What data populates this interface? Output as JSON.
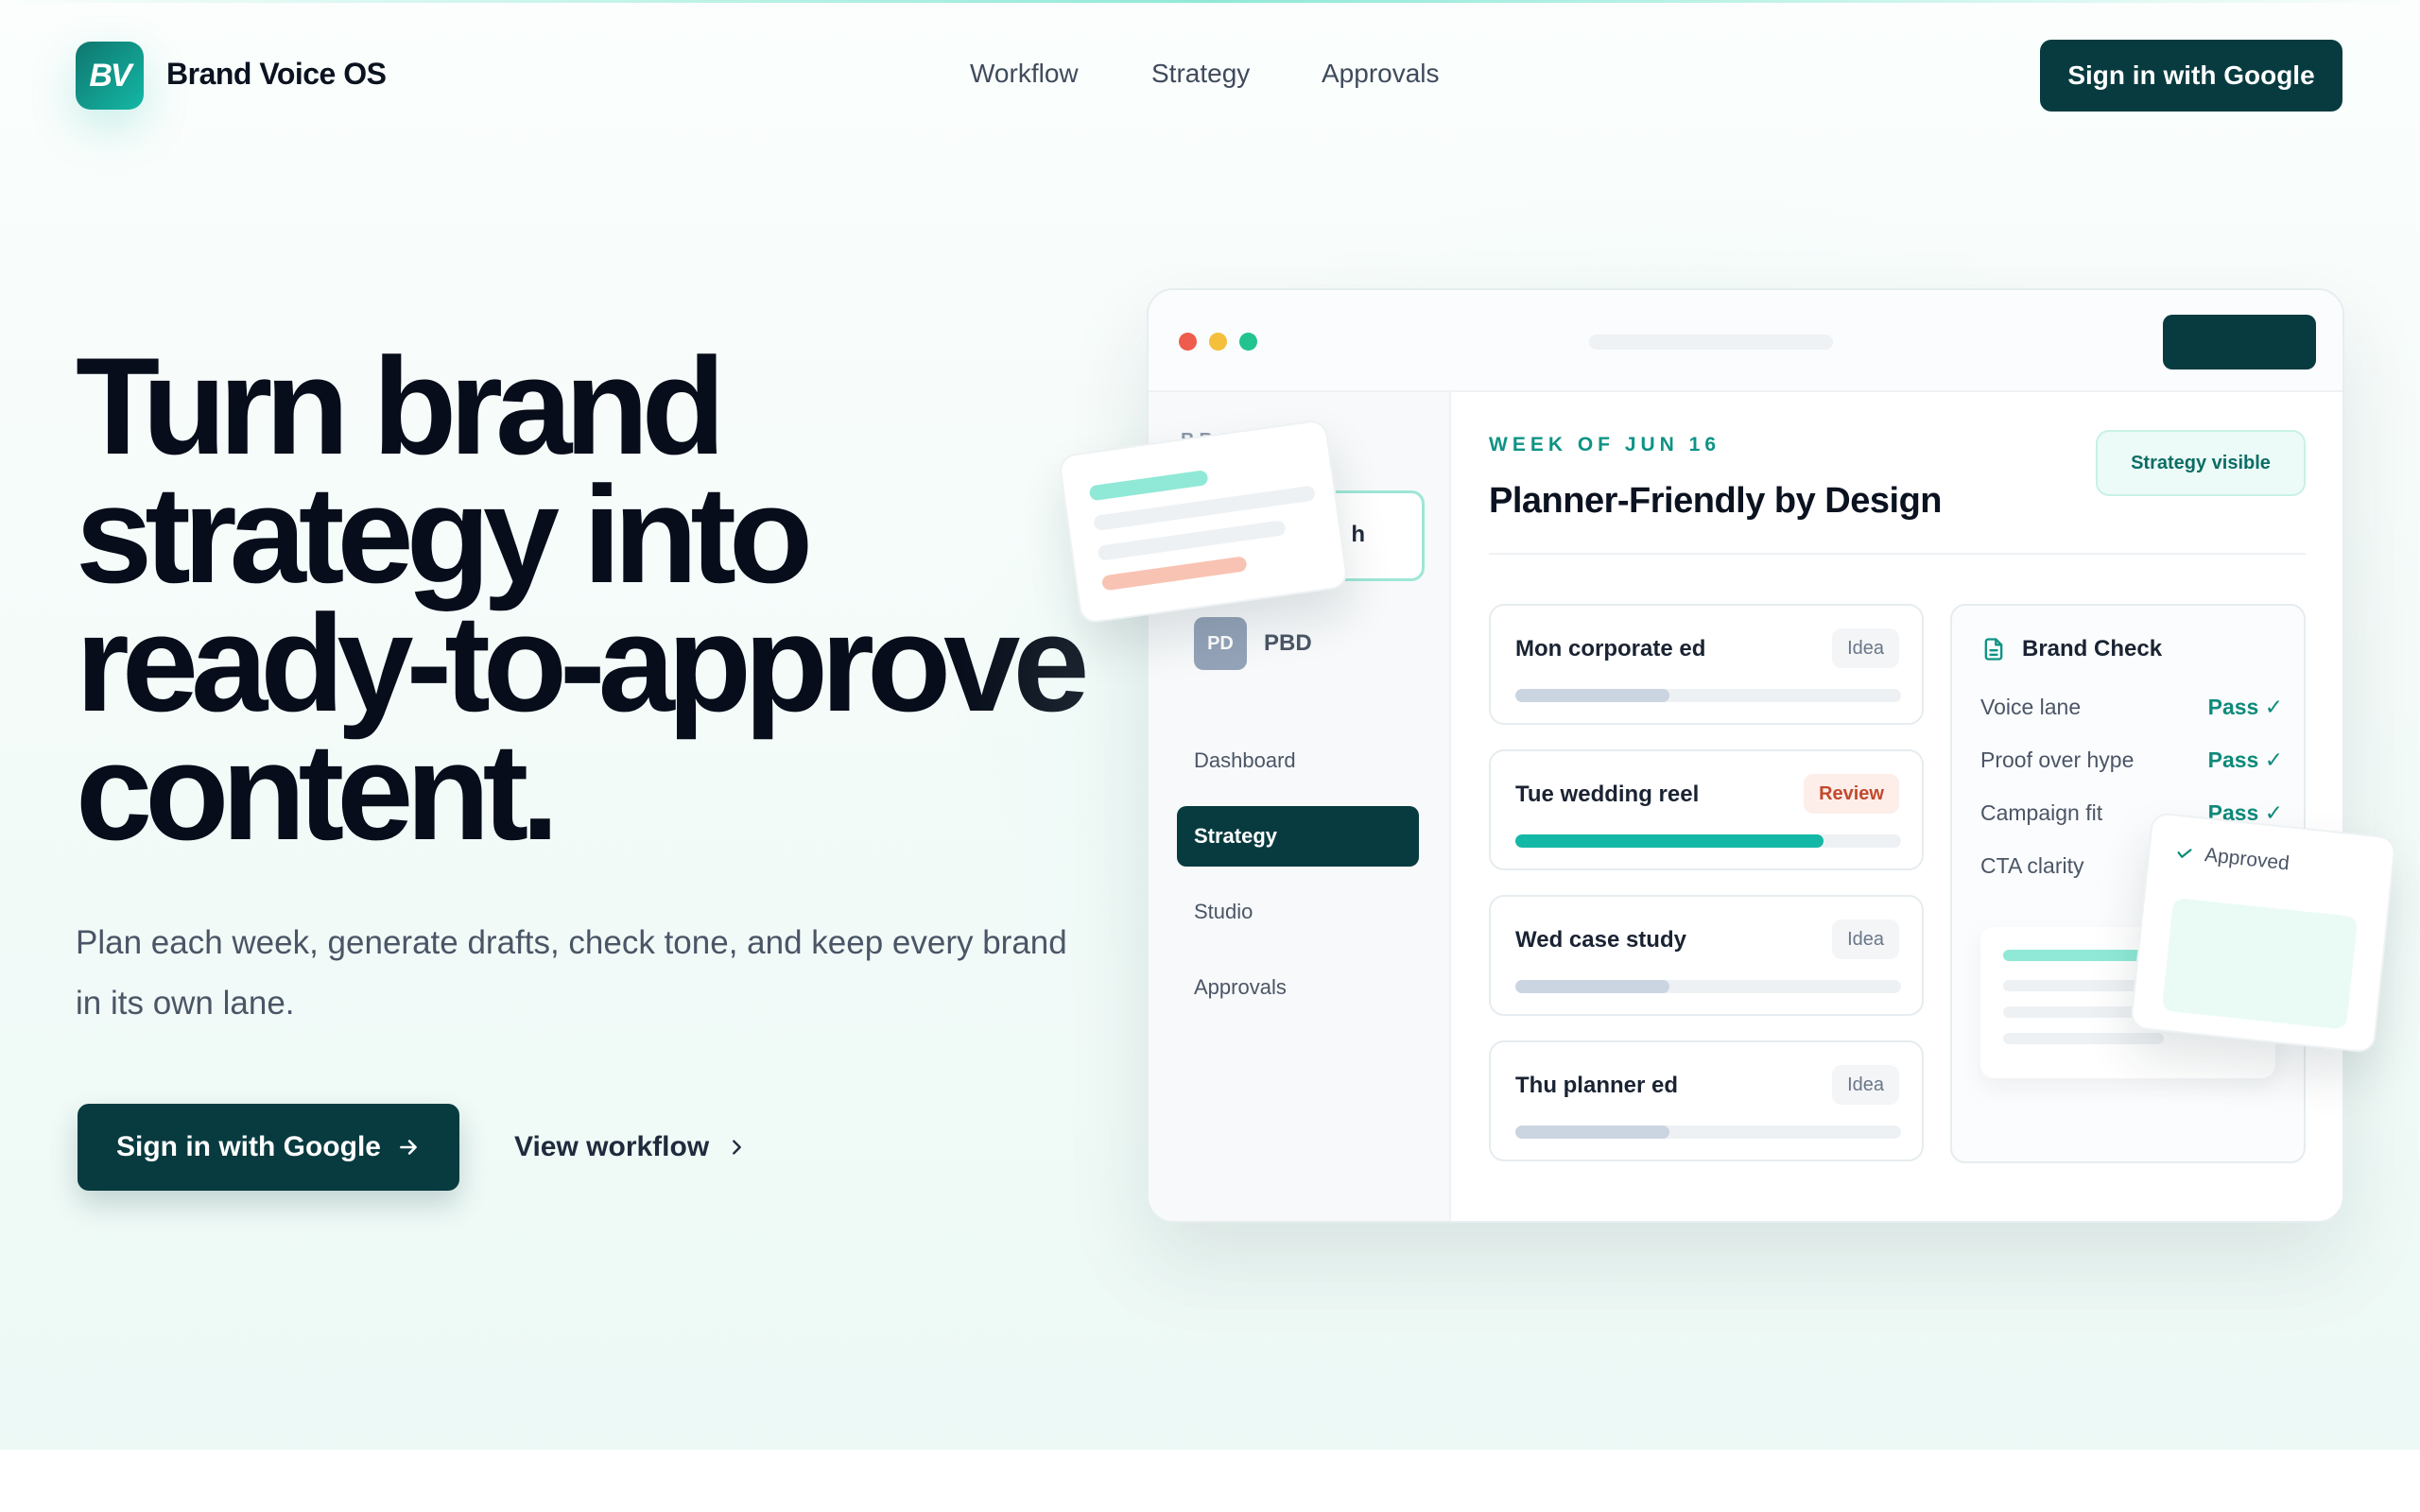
{
  "nav": {
    "logo_mark": "BV",
    "brand_name": "Brand Voice OS",
    "links": [
      "Workflow",
      "Strategy",
      "Approvals"
    ],
    "signin_label": "Sign in with Google"
  },
  "hero": {
    "title": "Turn brand strategy into ready-to-approve content.",
    "subtitle": "Plan each week, generate drafts, check tone, and keep every brand in its own lane.",
    "cta_primary": "Sign in with Google",
    "cta_primary_icon": "arrow-right-icon",
    "cta_secondary": "View workflow",
    "cta_secondary_icon": "chevron-right-icon"
  },
  "mockup": {
    "sidebar": {
      "brands_label": "BRANDS",
      "active_brand_visible_text": "h",
      "other_brand": {
        "initials": "PD",
        "name": "PBD"
      },
      "items": [
        "Dashboard",
        "Strategy",
        "Studio",
        "Approvals"
      ],
      "active_item": "Strategy"
    },
    "week_label": "WEEK OF JUN 16",
    "title": "Planner-Friendly by Design",
    "status_pill": "Strategy visible",
    "cards": [
      {
        "title": "Mon corporate ed",
        "tag": "Idea",
        "progress": 0.4
      },
      {
        "title": "Tue wedding reel",
        "tag": "Review",
        "progress": 0.8
      },
      {
        "title": "Wed case study",
        "tag": "Idea",
        "progress": 0.4
      },
      {
        "title": "Thu planner ed",
        "tag": "Idea",
        "progress": 0.4
      }
    ],
    "brand_check": {
      "title": "Brand Check",
      "icon": "document-icon",
      "rows": [
        {
          "label": "Voice lane",
          "value": "Pass"
        },
        {
          "label": "Proof over hype",
          "value": "Pass"
        },
        {
          "label": "Campaign fit",
          "value": "Pass"
        },
        {
          "label": "CTA clarity",
          "value": ""
        }
      ]
    },
    "approved_badge": "Approved"
  },
  "colors": {
    "accent_dark": "#083b40",
    "accent_teal": "#14b8a6",
    "pass_green": "#0e8a7a",
    "review_red": "#c2492d",
    "dot_red": "#ef5b4c",
    "dot_yellow": "#f4bf3a",
    "dot_green": "#22c38e"
  }
}
